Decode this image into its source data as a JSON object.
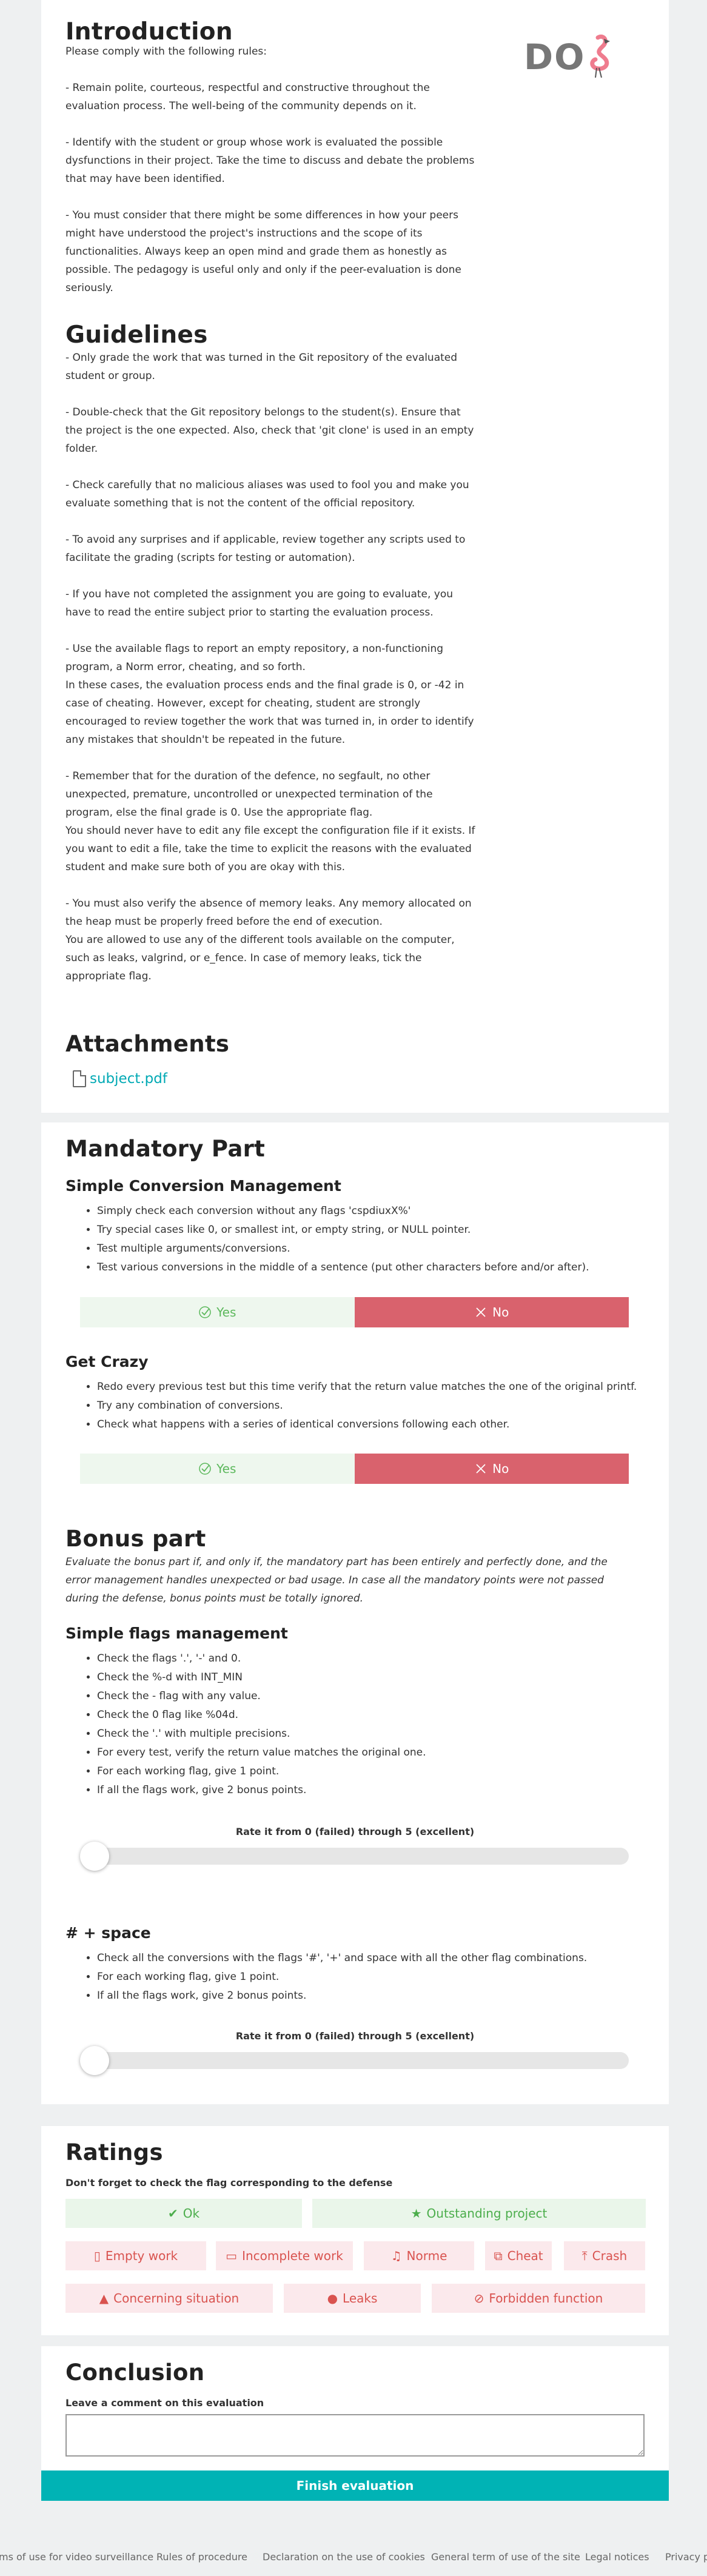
{
  "intro": {
    "title": "Introduction",
    "text": "Please comply with the following rules:\n\n- Remain polite, courteous, respectful and constructive throughout the evaluation process. The well-being of the community depends on it.\n\n- Identify with the student or group whose work is evaluated the possible dysfunctions in their project. Take the time to discuss and debate the problems that may have been identified.\n\n- You must consider that there might be some differences in how your peers might have understood the project's instructions and the scope of its functionalities. Always keep an open mind and grade them as honestly as possible. The pedagogy is useful only and only if the peer-evaluation is done seriously."
  },
  "logo": {
    "text": "DO",
    "icon": "flamingo-icon"
  },
  "guidelines": {
    "title": "Guidelines",
    "text": "- Only grade the work that was turned in the Git repository of the evaluated student or group.\n\n- Double-check that the Git repository belongs to the student(s). Ensure that the project is the one expected. Also, check that 'git clone' is used in an empty folder.\n\n- Check carefully that no malicious aliases was used to fool you and make you evaluate something that is not the content of the official repository.\n\n- To avoid any surprises and if applicable, review together any scripts used to facilitate the grading (scripts for testing or automation).\n\n- If you have not completed the assignment you are going to evaluate, you have to read the entire subject prior to starting the evaluation process.\n\n- Use the available flags to report an empty repository, a non-functioning program, a Norm error, cheating, and so forth.\nIn these cases, the evaluation process ends and the final grade is 0, or -42 in case of cheating. However, except for cheating, student are strongly encouraged to review together the work that was turned in, in order to identify any mistakes that shouldn't be repeated in the future.\n\n- Remember that for the duration of the defence, no segfault, no other unexpected, premature, uncontrolled or unexpected termination of the program, else the final grade is 0. Use the appropriate flag.\nYou should never have to edit any file except the configuration file if it exists. If you want to edit a file, take the time to explicit the reasons with the evaluated student and make sure both of you are okay with this.\n\n- You must also verify the absence of memory leaks. Any memory allocated on the heap must be properly freed before the end of execution.\nYou are allowed to use any of the different tools available on the computer, such as leaks, valgrind, or e_fence. In case of memory leaks, tick the appropriate flag."
  },
  "attachments": {
    "title": "Attachments",
    "file": "subject.pdf"
  },
  "mandatory": {
    "title": "Mandatory Part",
    "sections": [
      {
        "title": "Simple Conversion Management",
        "items": [
          "Simply check each conversion without any flags 'cspdiuxX%'",
          "Try special cases like 0, or smallest int, or empty string, or NULL pointer.",
          "Test multiple arguments/conversions.",
          "Test various conversions in the middle of a sentence (put other characters before and/or after)."
        ],
        "yes": "Yes",
        "no": "No"
      },
      {
        "title": "Get Crazy",
        "items": [
          "Redo every previous test but this time verify that the return value matches the one of the original printf.",
          "Try any combination of conversions.",
          "Check what happens with a series of identical conversions following each other."
        ],
        "yes": "Yes",
        "no": "No"
      }
    ]
  },
  "bonus": {
    "title": "Bonus part",
    "intro": "Evaluate the bonus part if, and only if, the mandatory part has been entirely and perfectly done, and the error management handles unexpected or bad usage. In case all the mandatory points were not passed during the defense, bonus points must be totally ignored.",
    "sections": [
      {
        "title": "Simple flags management",
        "items": [
          "Check the flags '.', '-' and 0.",
          "Check the %-d with INT_MIN",
          "Check the - flag with any value.",
          "Check the 0 flag like %04d.",
          "Check the '.' with multiple precisions.",
          "For every test, verify the return value matches the original one.",
          "For each working flag, give 1 point.",
          "If all the flags work, give 2 bonus points."
        ],
        "rate_label": "Rate it from 0 (failed) through 5 (excellent)",
        "value": 0
      },
      {
        "title": "# + space",
        "items": [
          "Check all the conversions with the flags '#', '+' and space with all the other flag combinations.",
          "For each working flag, give 1 point.",
          "If all the flags work, give 2 bonus points."
        ],
        "rate_label": "Rate it from 0 (failed) through 5 (excellent)",
        "value": 0
      }
    ]
  },
  "ratings": {
    "title": "Ratings",
    "subtitle": "Don't forget to check the flag corresponding to the defense",
    "ok": "Ok",
    "outstanding": "Outstanding project",
    "flags": {
      "empty": "Empty work",
      "incomplete": "Incomplete work",
      "norme": "Norme",
      "cheat": "Cheat",
      "crash": "Crash",
      "concerning": "Concerning situation",
      "leaks": "Leaks",
      "forbidden": "Forbidden function"
    }
  },
  "conclusion": {
    "title": "Conclusion",
    "label": "Leave a comment on this evaluation",
    "comment": ""
  },
  "finish_label": "Finish evaluation",
  "footer": {
    "terms_video": "ms of use for video surveillance",
    "rules": "Rules of procedure",
    "cookies": "Declaration on the use of cookies",
    "general_terms": "General term of use of the site",
    "legal": "Legal notices",
    "privacy": "Privacy p"
  },
  "colors": {
    "accent": "#00b3b5",
    "no_red": "#d9626d",
    "yes_green": "#5cb85c",
    "flag_red": "#d9534f"
  }
}
